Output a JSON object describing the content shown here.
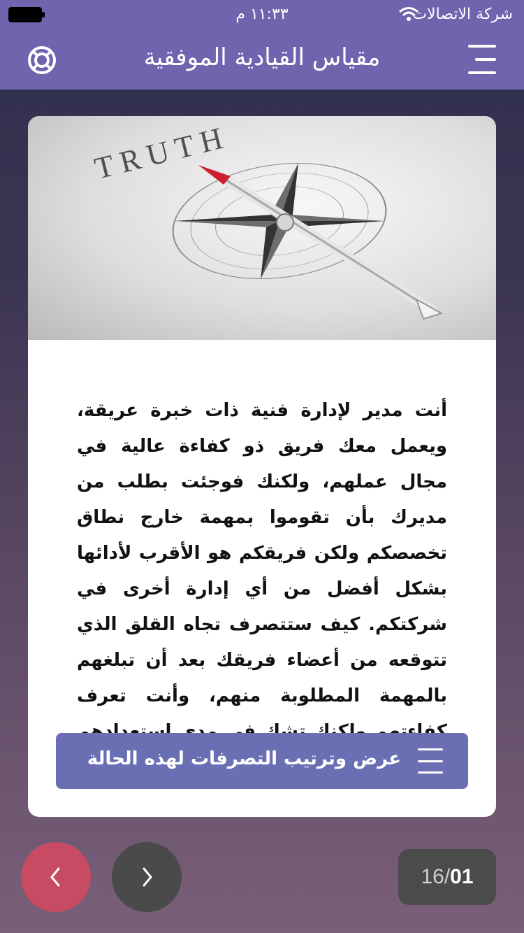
{
  "status_bar": {
    "carrier": "شركة الاتصالات",
    "time": "١١:٣٣ م"
  },
  "header": {
    "title": "مقياس القيادية الموفقية",
    "menu_icon": "hamburger-menu-icon",
    "support_icon": "lifebuoy-icon"
  },
  "card": {
    "image_text": "TRUTH",
    "question": "أنت مدير لإدارة فنية ذات خبرة عريقة، ويعمل معك فريق ذو كفاءة عالية في مجال عملهم، ولكنك فوجئت بطلب من مديرك بأن تقوموا بمهمة خارج نطاق تخصصكم ولكن فريقكم هو الأقرب لأدائها بشكل أفضل من أي إدارة أخرى في شركتكم. كيف ستتصرف تجاه القلق الذي تتوقعه من أعضاء فريقك بعد أن تبلغهم بالمهمة المطلوبة منهم، وأنت تعرف كفاءتهم ولكنك تشك في مدى استعدادهم للقيام بهذه المهمة بحماس ؟",
    "action_label": "عرض وترتيب التصرفات لهذه الحالة"
  },
  "pagination": {
    "current": "01",
    "separator": "/",
    "total": "16"
  },
  "colors": {
    "header_bg": "#6f64ad",
    "button_bg": "#6a6fb3",
    "prev_bg": "#c84b64",
    "next_bg": "#4a4a4a"
  }
}
